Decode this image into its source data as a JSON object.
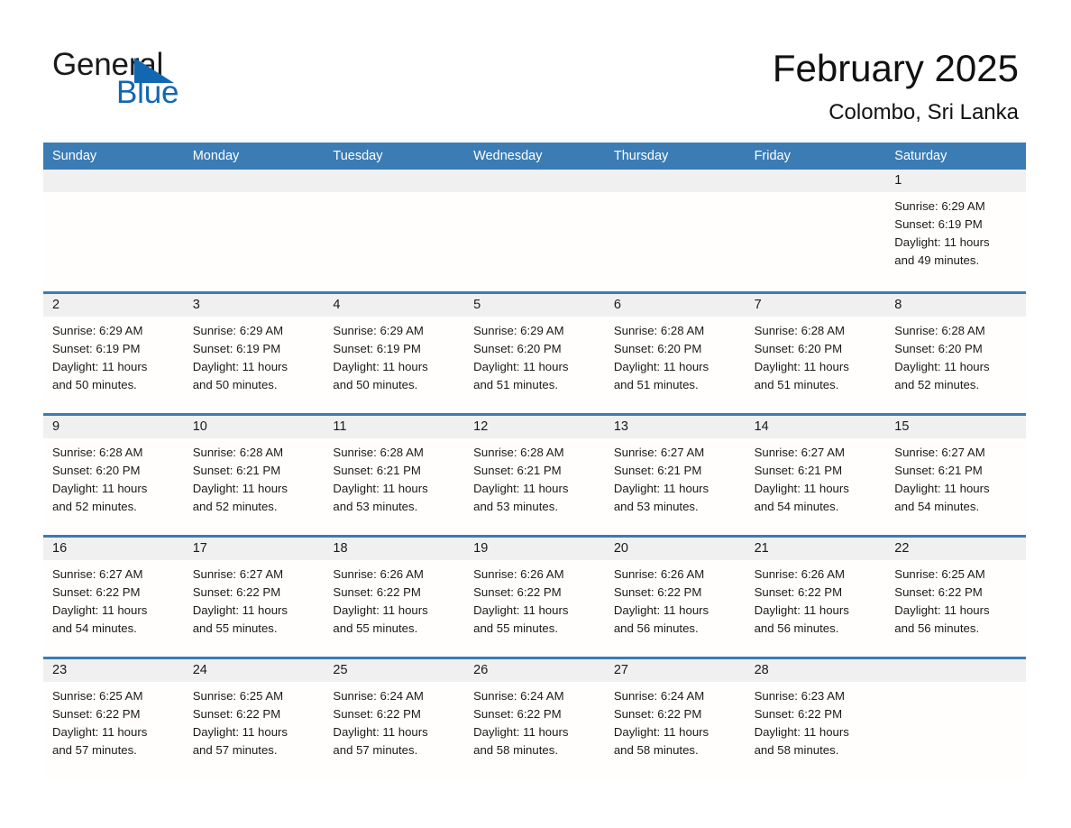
{
  "brand": {
    "name_part1": "General",
    "name_part2": "Blue",
    "triangle_icon": "triangle-icon",
    "accent_color": "#1167b1"
  },
  "header": {
    "title": "February 2025",
    "location": "Colombo, Sri Lanka"
  },
  "colors": {
    "header_blue": "#3b7cb5",
    "daynum_band": "#f0f0f0",
    "text": "#1a1a1a"
  },
  "weekdays": [
    "Sunday",
    "Monday",
    "Tuesday",
    "Wednesday",
    "Thursday",
    "Friday",
    "Saturday"
  ],
  "weeks": [
    [
      {
        "day": "",
        "blank": true
      },
      {
        "day": "",
        "blank": true
      },
      {
        "day": "",
        "blank": true
      },
      {
        "day": "",
        "blank": true
      },
      {
        "day": "",
        "blank": true
      },
      {
        "day": "",
        "blank": true
      },
      {
        "day": "1",
        "sunrise": "Sunrise: 6:29 AM",
        "sunset": "Sunset: 6:19 PM",
        "daylight1": "Daylight: 11 hours",
        "daylight2": "and 49 minutes."
      }
    ],
    [
      {
        "day": "2",
        "sunrise": "Sunrise: 6:29 AM",
        "sunset": "Sunset: 6:19 PM",
        "daylight1": "Daylight: 11 hours",
        "daylight2": "and 50 minutes."
      },
      {
        "day": "3",
        "sunrise": "Sunrise: 6:29 AM",
        "sunset": "Sunset: 6:19 PM",
        "daylight1": "Daylight: 11 hours",
        "daylight2": "and 50 minutes."
      },
      {
        "day": "4",
        "sunrise": "Sunrise: 6:29 AM",
        "sunset": "Sunset: 6:19 PM",
        "daylight1": "Daylight: 11 hours",
        "daylight2": "and 50 minutes."
      },
      {
        "day": "5",
        "sunrise": "Sunrise: 6:29 AM",
        "sunset": "Sunset: 6:20 PM",
        "daylight1": "Daylight: 11 hours",
        "daylight2": "and 51 minutes."
      },
      {
        "day": "6",
        "sunrise": "Sunrise: 6:28 AM",
        "sunset": "Sunset: 6:20 PM",
        "daylight1": "Daylight: 11 hours",
        "daylight2": "and 51 minutes."
      },
      {
        "day": "7",
        "sunrise": "Sunrise: 6:28 AM",
        "sunset": "Sunset: 6:20 PM",
        "daylight1": "Daylight: 11 hours",
        "daylight2": "and 51 minutes."
      },
      {
        "day": "8",
        "sunrise": "Sunrise: 6:28 AM",
        "sunset": "Sunset: 6:20 PM",
        "daylight1": "Daylight: 11 hours",
        "daylight2": "and 52 minutes."
      }
    ],
    [
      {
        "day": "9",
        "sunrise": "Sunrise: 6:28 AM",
        "sunset": "Sunset: 6:20 PM",
        "daylight1": "Daylight: 11 hours",
        "daylight2": "and 52 minutes."
      },
      {
        "day": "10",
        "sunrise": "Sunrise: 6:28 AM",
        "sunset": "Sunset: 6:21 PM",
        "daylight1": "Daylight: 11 hours",
        "daylight2": "and 52 minutes."
      },
      {
        "day": "11",
        "sunrise": "Sunrise: 6:28 AM",
        "sunset": "Sunset: 6:21 PM",
        "daylight1": "Daylight: 11 hours",
        "daylight2": "and 53 minutes."
      },
      {
        "day": "12",
        "sunrise": "Sunrise: 6:28 AM",
        "sunset": "Sunset: 6:21 PM",
        "daylight1": "Daylight: 11 hours",
        "daylight2": "and 53 minutes."
      },
      {
        "day": "13",
        "sunrise": "Sunrise: 6:27 AM",
        "sunset": "Sunset: 6:21 PM",
        "daylight1": "Daylight: 11 hours",
        "daylight2": "and 53 minutes."
      },
      {
        "day": "14",
        "sunrise": "Sunrise: 6:27 AM",
        "sunset": "Sunset: 6:21 PM",
        "daylight1": "Daylight: 11 hours",
        "daylight2": "and 54 minutes."
      },
      {
        "day": "15",
        "sunrise": "Sunrise: 6:27 AM",
        "sunset": "Sunset: 6:21 PM",
        "daylight1": "Daylight: 11 hours",
        "daylight2": "and 54 minutes."
      }
    ],
    [
      {
        "day": "16",
        "sunrise": "Sunrise: 6:27 AM",
        "sunset": "Sunset: 6:22 PM",
        "daylight1": "Daylight: 11 hours",
        "daylight2": "and 54 minutes."
      },
      {
        "day": "17",
        "sunrise": "Sunrise: 6:27 AM",
        "sunset": "Sunset: 6:22 PM",
        "daylight1": "Daylight: 11 hours",
        "daylight2": "and 55 minutes."
      },
      {
        "day": "18",
        "sunrise": "Sunrise: 6:26 AM",
        "sunset": "Sunset: 6:22 PM",
        "daylight1": "Daylight: 11 hours",
        "daylight2": "and 55 minutes."
      },
      {
        "day": "19",
        "sunrise": "Sunrise: 6:26 AM",
        "sunset": "Sunset: 6:22 PM",
        "daylight1": "Daylight: 11 hours",
        "daylight2": "and 55 minutes."
      },
      {
        "day": "20",
        "sunrise": "Sunrise: 6:26 AM",
        "sunset": "Sunset: 6:22 PM",
        "daylight1": "Daylight: 11 hours",
        "daylight2": "and 56 minutes."
      },
      {
        "day": "21",
        "sunrise": "Sunrise: 6:26 AM",
        "sunset": "Sunset: 6:22 PM",
        "daylight1": "Daylight: 11 hours",
        "daylight2": "and 56 minutes."
      },
      {
        "day": "22",
        "sunrise": "Sunrise: 6:25 AM",
        "sunset": "Sunset: 6:22 PM",
        "daylight1": "Daylight: 11 hours",
        "daylight2": "and 56 minutes."
      }
    ],
    [
      {
        "day": "23",
        "sunrise": "Sunrise: 6:25 AM",
        "sunset": "Sunset: 6:22 PM",
        "daylight1": "Daylight: 11 hours",
        "daylight2": "and 57 minutes."
      },
      {
        "day": "24",
        "sunrise": "Sunrise: 6:25 AM",
        "sunset": "Sunset: 6:22 PM",
        "daylight1": "Daylight: 11 hours",
        "daylight2": "and 57 minutes."
      },
      {
        "day": "25",
        "sunrise": "Sunrise: 6:24 AM",
        "sunset": "Sunset: 6:22 PM",
        "daylight1": "Daylight: 11 hours",
        "daylight2": "and 57 minutes."
      },
      {
        "day": "26",
        "sunrise": "Sunrise: 6:24 AM",
        "sunset": "Sunset: 6:22 PM",
        "daylight1": "Daylight: 11 hours",
        "daylight2": "and 58 minutes."
      },
      {
        "day": "27",
        "sunrise": "Sunrise: 6:24 AM",
        "sunset": "Sunset: 6:22 PM",
        "daylight1": "Daylight: 11 hours",
        "daylight2": "and 58 minutes."
      },
      {
        "day": "28",
        "sunrise": "Sunrise: 6:23 AM",
        "sunset": "Sunset: 6:22 PM",
        "daylight1": "Daylight: 11 hours",
        "daylight2": "and 58 minutes."
      },
      {
        "day": "",
        "blank": true
      }
    ]
  ]
}
